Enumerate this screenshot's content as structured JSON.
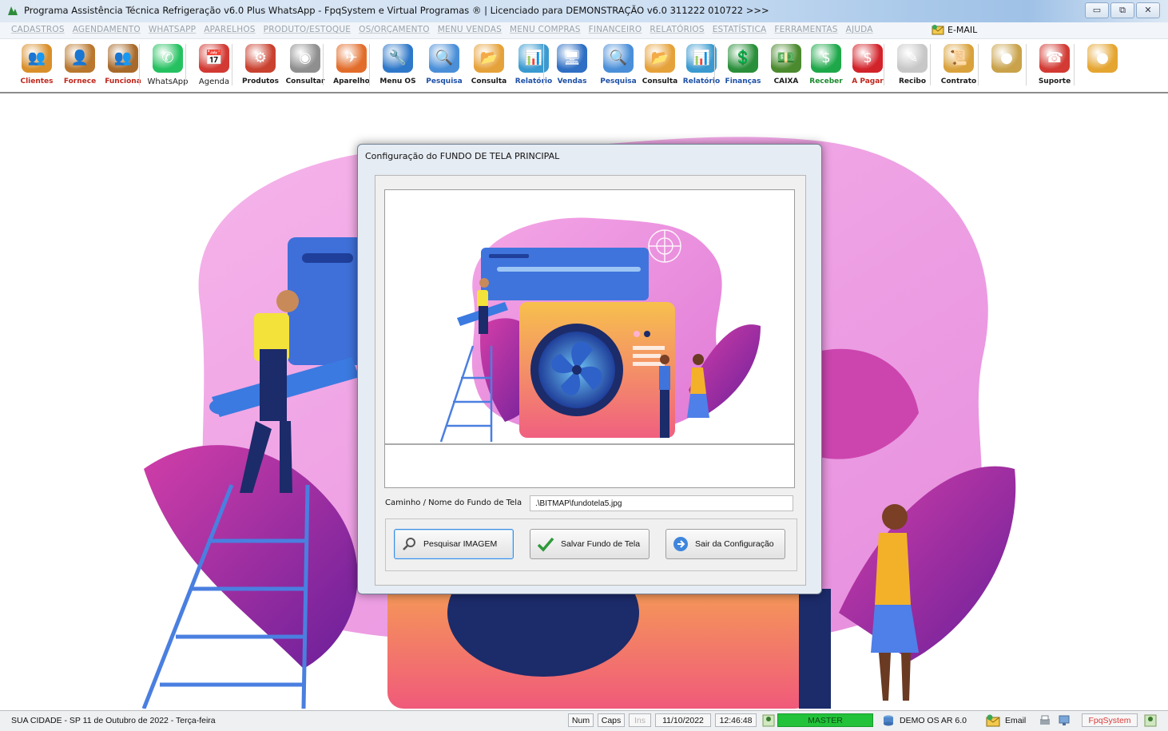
{
  "window": {
    "title": "Programa Assistência Técnica Refrigeração v6.0 Plus WhatsApp - FpqSystem e Virtual Programas ® | Licenciado para  DEMONSTRAÇÃO v6.0 311222 010722 >>>",
    "controls": [
      "▭",
      "⧉",
      "✕"
    ]
  },
  "menu": {
    "items": [
      "CADASTROS",
      "AGENDAMENTO",
      "WHATSAPP",
      "APARELHOS",
      "PRODUTO/ESTOQUE",
      "OS/ORÇAMENTO",
      "MENU VENDAS",
      "MENU COMPRAS",
      "FINANCEIRO",
      "RELATÓRIOS",
      "ESTATÍSTICA",
      "FERRAMENTAS",
      "AJUDA"
    ],
    "email": "E-MAIL"
  },
  "toolbar": {
    "buttons": [
      {
        "label": "Clientes",
        "color": "#d98f2a",
        "style": "red"
      },
      {
        "label": "Fornece",
        "color": "#b9782e",
        "style": "red"
      },
      {
        "label": "Funciona",
        "color": "#a86a2a",
        "style": "red"
      },
      {
        "label": "WhatsApp",
        "color": "#25c160",
        "style": "plain"
      },
      {
        "label": "Agenda",
        "color": "#d23a33",
        "style": "plain"
      },
      {
        "label": "Produtos",
        "color": "#c9412f",
        "style": "bold"
      },
      {
        "label": "Consultar",
        "color": "#8f8f8f",
        "style": "bold"
      },
      {
        "label": "Aparelho",
        "color": "#e26d2b",
        "style": "bold"
      },
      {
        "label": "Menu OS",
        "color": "#2e78c9",
        "style": "bold"
      },
      {
        "label": "Pesquisa",
        "color": "#4a8fd8",
        "style": "blue"
      },
      {
        "label": "Consulta",
        "color": "#e6a23a",
        "style": "bold"
      },
      {
        "label": "Relatório",
        "color": "#3a9ad0",
        "style": "blue"
      },
      {
        "label": "Vendas",
        "color": "#2f6fc4",
        "style": "blue"
      },
      {
        "label": "Pesquisa",
        "color": "#4a8fd8",
        "style": "blue"
      },
      {
        "label": "Consulta",
        "color": "#e6a23a",
        "style": "bold"
      },
      {
        "label": "Relatório",
        "color": "#3a9ad0",
        "style": "blue"
      },
      {
        "label": "Finanças",
        "color": "#2a8f3a",
        "style": "blue"
      },
      {
        "label": "CAIXA",
        "color": "#4b8a2e",
        "style": "bold"
      },
      {
        "label": "Receber",
        "color": "#1ea84a",
        "style": "green"
      },
      {
        "label": "A Pagar",
        "color": "#d2232a",
        "style": "red"
      },
      {
        "label": "Recibo",
        "color": "#c7c7c7",
        "style": "bold"
      },
      {
        "label": "Contrato",
        "color": "#d9a23c",
        "style": "bold"
      },
      {
        "label": "",
        "color": "#c9a24a",
        "style": "bold"
      },
      {
        "label": "Suporte",
        "color": "#d23a33",
        "style": "bold"
      },
      {
        "label": "",
        "color": "#e5a531",
        "style": "bold"
      }
    ]
  },
  "dialog": {
    "title": "Configuração do FUNDO DE TELA PRINCIPAL",
    "path_label": "Caminho / Nome do Fundo de Tela",
    "path_value": ".\\BITMAP\\fundotela5.jpg",
    "btn_search": "Pesquisar IMAGEM",
    "btn_save": "Salvar Fundo de Tela",
    "btn_exit": "Sair da Configuração"
  },
  "statusbar": {
    "city": "SUA CIDADE - SP 11 de Outubro de 2022 - Terça-feira",
    "num": "Num",
    "caps": "Caps",
    "ins": "Ins",
    "date": "11/10/2022",
    "time": "12:46:48",
    "user": "MASTER",
    "db": "DEMO OS AR 6.0",
    "email": "Email",
    "brand": "FpqSystem"
  }
}
